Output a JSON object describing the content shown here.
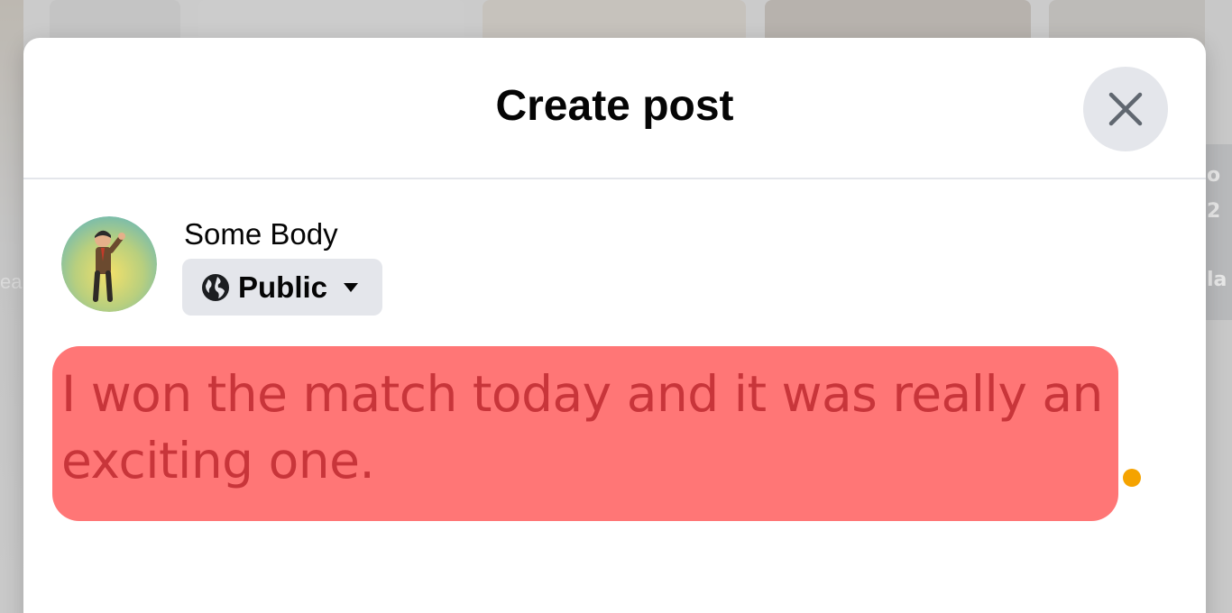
{
  "dialog": {
    "title": "Create post",
    "close_icon": "close-icon"
  },
  "author": {
    "name": "Some Body",
    "avatar_icon": "avatar-image"
  },
  "privacy": {
    "label": "Public",
    "icon": "globe-icon",
    "caret_icon": "caret-down-icon"
  },
  "composer": {
    "text": "I won the match today and it was really an exciting one.",
    "highlight_color": "#ff7676",
    "text_color": "#c8353a"
  },
  "background": {
    "right_card_glyphs": [
      "o",
      "2",
      "la"
    ],
    "left_ghost_text": "ea"
  },
  "colors": {
    "modal_bg": "#ffffff",
    "chip_bg": "#e4e6eb",
    "indicator": "#f5a300"
  }
}
